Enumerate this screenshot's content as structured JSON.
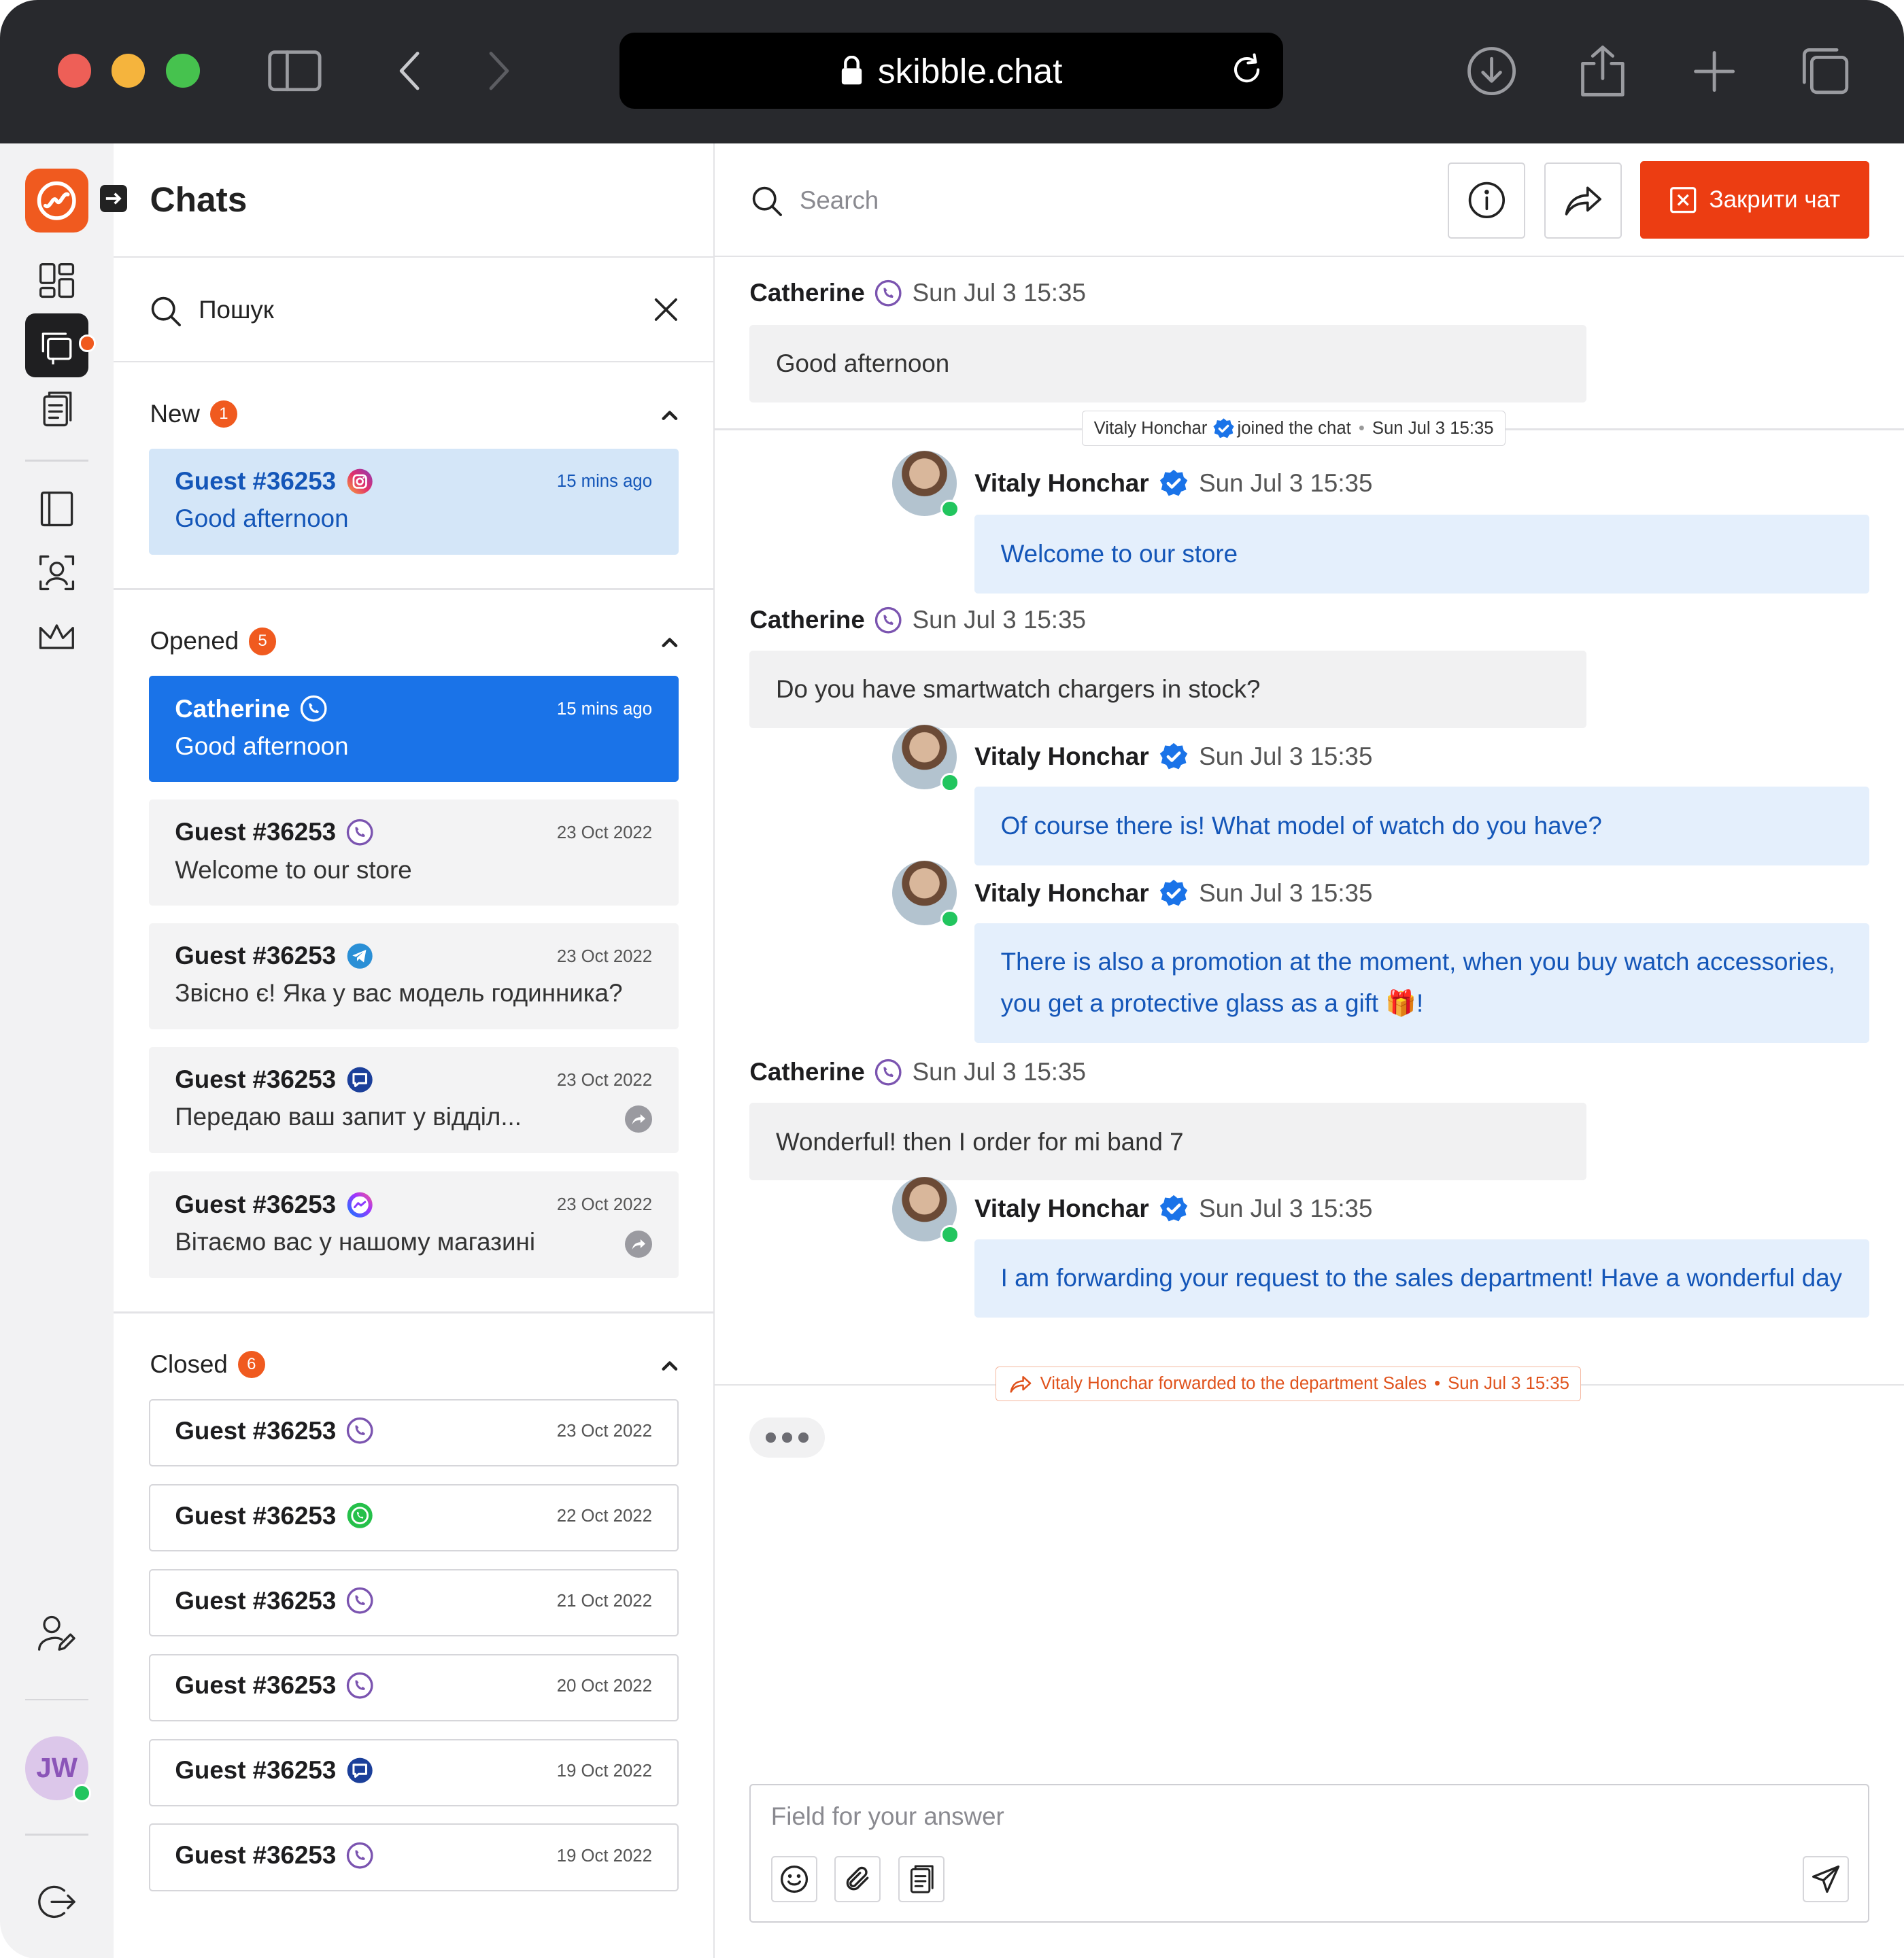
{
  "browser": {
    "url": "skibble.chat"
  },
  "colors": {
    "accent": "#f05a1f",
    "selected": "#1a73e8",
    "outgoing_bg": "#e4effc",
    "outgoing_text": "#1456b8",
    "danger": "#ec3d12"
  },
  "sidebar": {
    "title": "Chats",
    "avatar_initials": "JW",
    "search_value": "Пошук",
    "sections": {
      "new": {
        "label": "New",
        "count": "1"
      },
      "opened": {
        "label": "Opened",
        "count": "5"
      },
      "closed": {
        "label": "Closed",
        "count": "6"
      }
    },
    "new_chats": [
      {
        "name": "Guest #36253",
        "channel": "instagram-icon",
        "time": "15 mins ago",
        "message": "Good afternoon"
      }
    ],
    "opened_chats": [
      {
        "name": "Catherine",
        "channel": "viber-icon",
        "time": "15 mins ago",
        "message": "Good afternoon"
      },
      {
        "name": "Guest #36253",
        "channel": "viber-icon",
        "time": "23 Oct 2022",
        "message": "Welcome to our store"
      },
      {
        "name": "Guest #36253",
        "channel": "telegram-icon",
        "time": "23 Oct 2022",
        "message": "Звісно є! Яка у вас модель годинника?"
      },
      {
        "name": "Guest #36253",
        "channel": "livechat-icon",
        "time": "23 Oct 2022",
        "message": "Передаю ваш запит у відділ..."
      },
      {
        "name": "Guest #36253",
        "channel": "messenger-icon",
        "time": "23 Oct 2022",
        "message": "Вітаємо вас у нашому магазині"
      }
    ],
    "closed_chats": [
      {
        "name": "Guest #36253",
        "channel": "viber-icon",
        "time": "23 Oct 2022"
      },
      {
        "name": "Guest #36253",
        "channel": "whatsapp-icon",
        "time": "22 Oct 2022"
      },
      {
        "name": "Guest #36253",
        "channel": "viber-icon",
        "time": "21 Oct 2022"
      },
      {
        "name": "Guest #36253",
        "channel": "viber-icon",
        "time": "20 Oct 2022"
      },
      {
        "name": "Guest #36253",
        "channel": "livechat-icon",
        "time": "19 Oct 2022"
      },
      {
        "name": "Guest #36253",
        "channel": "viber-icon",
        "time": "19 Oct 2022"
      }
    ]
  },
  "chat": {
    "search_placeholder": "Search",
    "close_label": "Закрити чат",
    "messages": [
      {
        "author": "Catherine",
        "time": "Sun Jul 3 15:35",
        "text": "Good afternoon"
      },
      {
        "author": "Vitaly Honchar",
        "time": "Sun Jul 3 15:35",
        "text": "Welcome to our store"
      },
      {
        "author": "Catherine",
        "time": "Sun Jul 3 15:35",
        "text": "Do you have smartwatch chargers in stock?"
      },
      {
        "author": "Vitaly Honchar",
        "time": "Sun Jul 3 15:35",
        "text": "Of course there is! What model of watch do you have?"
      },
      {
        "author": "Vitaly Honchar",
        "time": "Sun Jul 3 15:35",
        "text": "There is also a promotion at the moment, when you buy watch accessories, you get a protective glass as a gift 🎁!"
      },
      {
        "author": "Catherine",
        "time": "Sun Jul 3 15:35",
        "text": "Wonderful! then I order for mi band 7"
      },
      {
        "author": "Vitaly Honchar",
        "time": "Sun Jul 3 15:35",
        "text": "I am forwarding your request to the sales department! Have a wonderful day"
      }
    ],
    "system_joined": {
      "name": "Vitaly Honchar",
      "action": "joined the chat",
      "time": "Sun Jul 3 15:35"
    },
    "system_forwarded": {
      "text": "Vitaly Honchar forwarded to the department Sales",
      "time": "Sun Jul 3 15:35"
    },
    "composer_placeholder": "Field for your answer"
  }
}
